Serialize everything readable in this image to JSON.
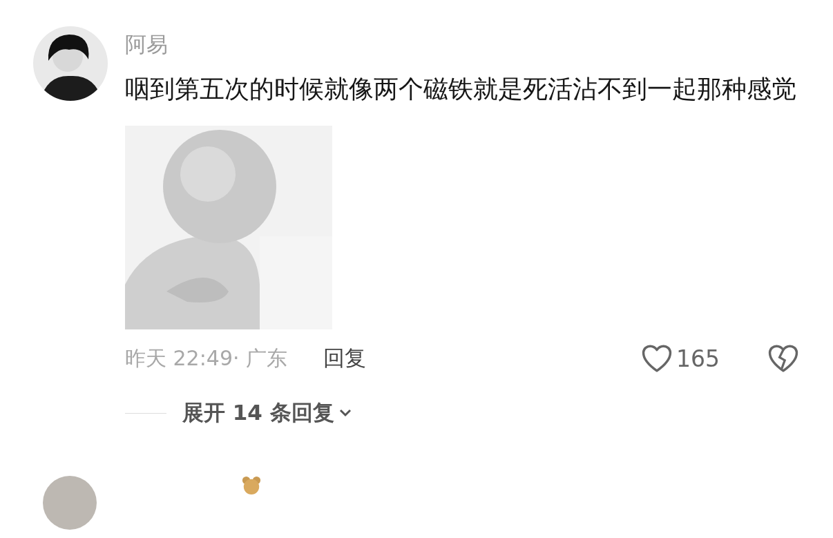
{
  "comment": {
    "author": "阿易",
    "text": "咽到第五次的时候就像两个磁铁就是死活沾不到一起那种感觉",
    "meta": "昨天 22:49· 广东",
    "reply_label": "回复",
    "likes": "165",
    "liked": false,
    "disliked": false,
    "expand_label": "展开 14 条回复"
  }
}
